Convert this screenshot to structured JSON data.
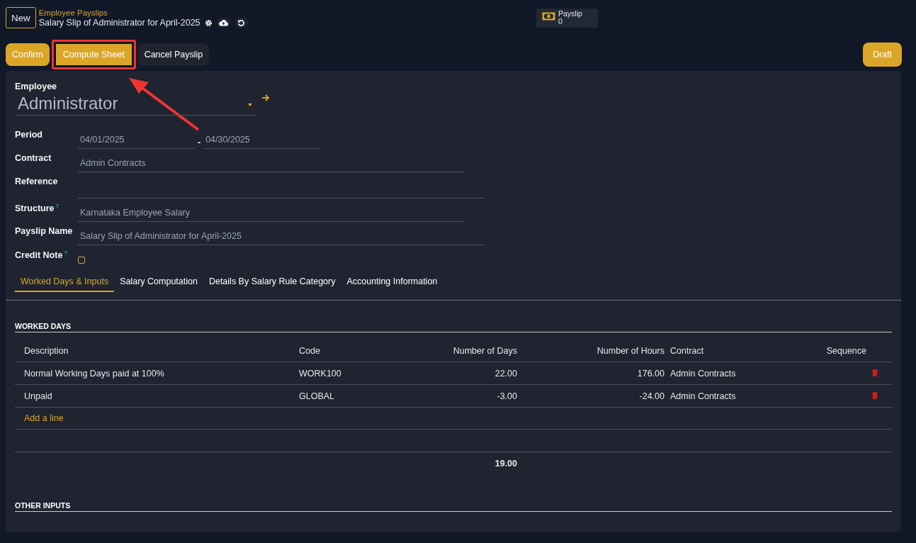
{
  "header": {
    "new_button": "New",
    "breadcrumb": "Employee Payslips",
    "title": "Salary Slip of Administrator for April-2025",
    "smart_button": {
      "label": "Payslip",
      "count": "0"
    }
  },
  "actions": [
    {
      "label": "Confirm",
      "primary": true,
      "highlighted": false
    },
    {
      "label": "Compute Sheet",
      "primary": true,
      "highlighted": true
    },
    {
      "label": "Cancel Payslip",
      "primary": false,
      "highlighted": false
    }
  ],
  "status": "Draft",
  "fields": [
    {
      "kind": "many2one",
      "label": "Employee",
      "value": "Administrator"
    },
    {
      "kind": "daterange",
      "label": "Period",
      "from": "04/01/2025",
      "separator": "-",
      "to": "04/30/2025"
    },
    {
      "kind": "text",
      "label": "Contract",
      "value": "Admin Contracts",
      "wide": false
    },
    {
      "kind": "text",
      "label": "Reference",
      "wide": true
    },
    {
      "kind": "text",
      "label": "Structure",
      "help": "?",
      "value": "Karnataka Employee Salary",
      "wide": false
    },
    {
      "kind": "text",
      "label": "Payslip Name",
      "value": "Salary Slip of Administrator for April-2025",
      "wide": true
    },
    {
      "kind": "checkbox",
      "label": "Credit Note",
      "help": "?",
      "checked": false
    }
  ],
  "tabs": [
    {
      "label": "Worked Days & Inputs",
      "selected": true
    },
    {
      "label": "Salary Computation",
      "selected": false
    },
    {
      "label": "Details By Salary Rule Category",
      "selected": false
    },
    {
      "label": "Accounting Information",
      "selected": false
    }
  ],
  "worked_days": {
    "title": "WORKED DAYS",
    "columns": [
      "Description",
      "Code",
      "Number of Days",
      "Number of Hours",
      "Contract",
      "Sequence"
    ],
    "rows": [
      {
        "description": "Normal Working Days paid at 100%",
        "code": "WORK100",
        "days": "22.00",
        "hours": "176.00",
        "contract": "Admin Contracts"
      },
      {
        "description": "Unpaid",
        "code": "GLOBAL",
        "days": "-3.00",
        "hours": "-24.00",
        "contract": "Admin Contracts"
      }
    ],
    "add_line": "Add a line",
    "total_days": "19.00"
  },
  "other_inputs": {
    "title": "OTHER INPUTS"
  }
}
